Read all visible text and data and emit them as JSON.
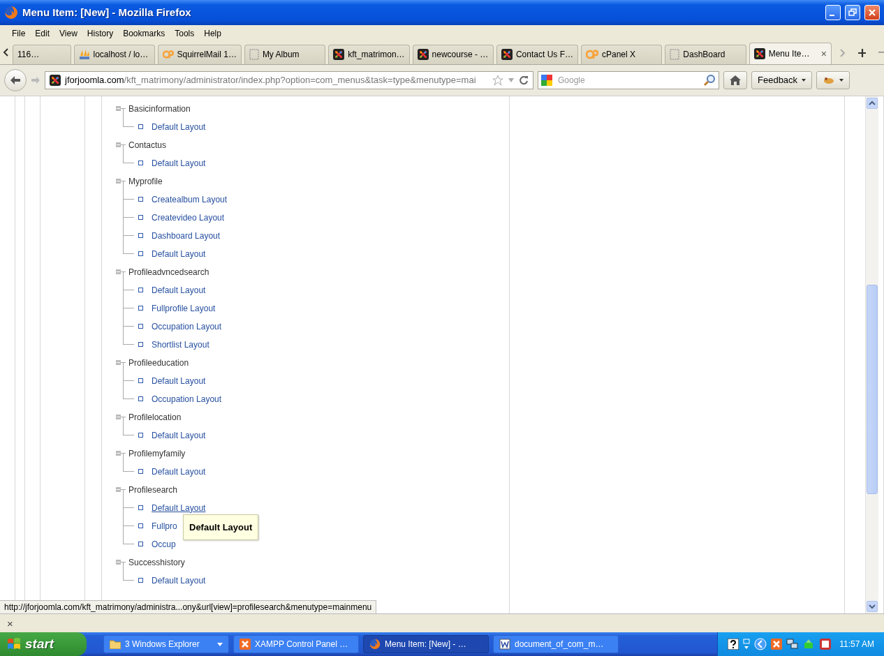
{
  "window": {
    "title": "Menu Item: [New] - Mozilla Firefox"
  },
  "menu": [
    "File",
    "Edit",
    "View",
    "History",
    "Bookmarks",
    "Tools",
    "Help"
  ],
  "tabs": [
    {
      "label": "116…",
      "kind": "none",
      "selected": false
    },
    {
      "label": "localhost / lo…",
      "kind": "pma",
      "selected": false
    },
    {
      "label": "SquirrelMail 1…",
      "kind": "cpanel",
      "selected": false
    },
    {
      "label": "My Album",
      "kind": "blank",
      "selected": false
    },
    {
      "label": "kft_matrimon…",
      "kind": "joomla",
      "selected": false
    },
    {
      "label": "newcourse - …",
      "kind": "joomla",
      "selected": false
    },
    {
      "label": "Contact Us F…",
      "kind": "joomla",
      "selected": false
    },
    {
      "label": "cPanel X",
      "kind": "cpanel",
      "selected": false
    },
    {
      "label": "DashBoard",
      "kind": "blank",
      "selected": false
    },
    {
      "label": "Menu Ite…",
      "kind": "joomla",
      "selected": true
    }
  ],
  "tab_close": "×",
  "address": {
    "domain": "jforjoomla.com",
    "path": "/kft_matrimony/administrator/index.php?option=com_menus&task=type&menutype=mai"
  },
  "search": {
    "placeholder": "Google"
  },
  "feedback": "Feedback",
  "tree": [
    {
      "label": "Basicinformation",
      "children": [
        {
          "label": "Default Layout",
          "hovered": false
        }
      ]
    },
    {
      "label": "Contactus",
      "children": [
        {
          "label": "Default Layout",
          "hovered": false
        }
      ]
    },
    {
      "label": "Myprofile",
      "children": [
        {
          "label": "Createalbum Layout",
          "hovered": false
        },
        {
          "label": "Createvideo Layout",
          "hovered": false
        },
        {
          "label": "Dashboard Layout",
          "hovered": false
        },
        {
          "label": "Default Layout",
          "hovered": false
        }
      ]
    },
    {
      "label": "Profileadvncedsearch",
      "children": [
        {
          "label": "Default Layout",
          "hovered": false
        },
        {
          "label": "Fullprofile Layout",
          "hovered": false
        },
        {
          "label": "Occupation Layout",
          "hovered": false
        },
        {
          "label": "Shortlist Layout",
          "hovered": false
        }
      ]
    },
    {
      "label": "Profileeducation",
      "children": [
        {
          "label": "Default Layout",
          "hovered": false
        },
        {
          "label": "Occupation Layout",
          "hovered": false
        }
      ]
    },
    {
      "label": "Profilelocation",
      "children": [
        {
          "label": "Default Layout",
          "hovered": false
        }
      ]
    },
    {
      "label": "Profilemyfamily",
      "children": [
        {
          "label": "Default Layout",
          "hovered": false
        }
      ]
    },
    {
      "label": "Profilesearch",
      "children": [
        {
          "label": "Default Layout",
          "hovered": true,
          "tooltip": "Default Layout"
        },
        {
          "label": "Fullpro",
          "hovered": false
        },
        {
          "label": "Occup",
          "hovered": false
        }
      ]
    },
    {
      "label": "Successhistory",
      "children": [
        {
          "label": "Default Layout",
          "hovered": false
        }
      ]
    }
  ],
  "status_url": "http://jforjoomla.com/kft_matrimony/administra...ony&url[view]=profilesearch&menutype=mainmenu",
  "findbar_close": "×",
  "taskbar": {
    "start": "start",
    "buttons": [
      {
        "label": "3 Windows Explorer",
        "kind": "folder",
        "selected": false
      },
      {
        "label": "XAMPP Control Panel …",
        "kind": "xampp",
        "selected": false
      },
      {
        "label": "Menu Item: [New] - …",
        "kind": "firefox",
        "selected": true
      },
      {
        "label": "document_of_com_m…",
        "kind": "word",
        "selected": false
      }
    ],
    "clock": "11:57 AM"
  }
}
